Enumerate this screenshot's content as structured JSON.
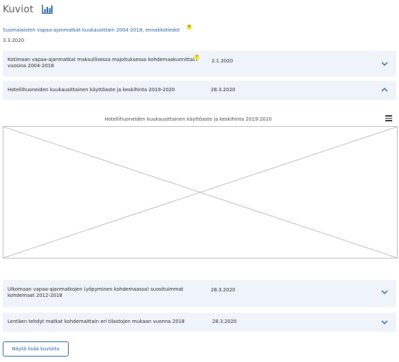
{
  "header": {
    "title": "Kuviot",
    "icon": "bar-chart-icon"
  },
  "intro": {
    "link_text": "Suomalaisten vapaa-ajanmatkat kuukausittain 2004-2018, ennakkotiedot",
    "badge": "8",
    "date": "3.3.2020"
  },
  "rows": [
    {
      "title": "Kotimaan vapaa-ajanmatkat maksullisessa majoituksessa kohdemaakunnittain vuosina 2004-2018",
      "badge": "7",
      "date": "2.1.2020",
      "expanded": false
    },
    {
      "title": "Hotellihuoneiden kuukausittainen käyttöaste ja keskihinta 2019-2020",
      "date": "28.3.2020",
      "expanded": true
    },
    {
      "title": "Ulkomaan vapaa-ajanmatkojen (yöpyminen kohdemaassa) suosituimmat kohdemaat 2012-2018",
      "date": "28.3.2020",
      "expanded": false
    },
    {
      "title": "Lentäen tehdyt matkat kohdemaittain eri tilastojen mukaan vuonna 2018",
      "date": "28.3.2020",
      "expanded": false
    }
  ],
  "chart": {
    "title": "Hotellihuoneiden kuukausittainen käyttöaste ja keskihinta 2019-2020",
    "menu_icon": "hamburger-menu-icon"
  },
  "more_button": {
    "label": "Näytä lisää kuvioita"
  },
  "colors": {
    "accent": "#1a5a9a",
    "row_bg": "#eef4f9",
    "badge": "#f4e842"
  }
}
